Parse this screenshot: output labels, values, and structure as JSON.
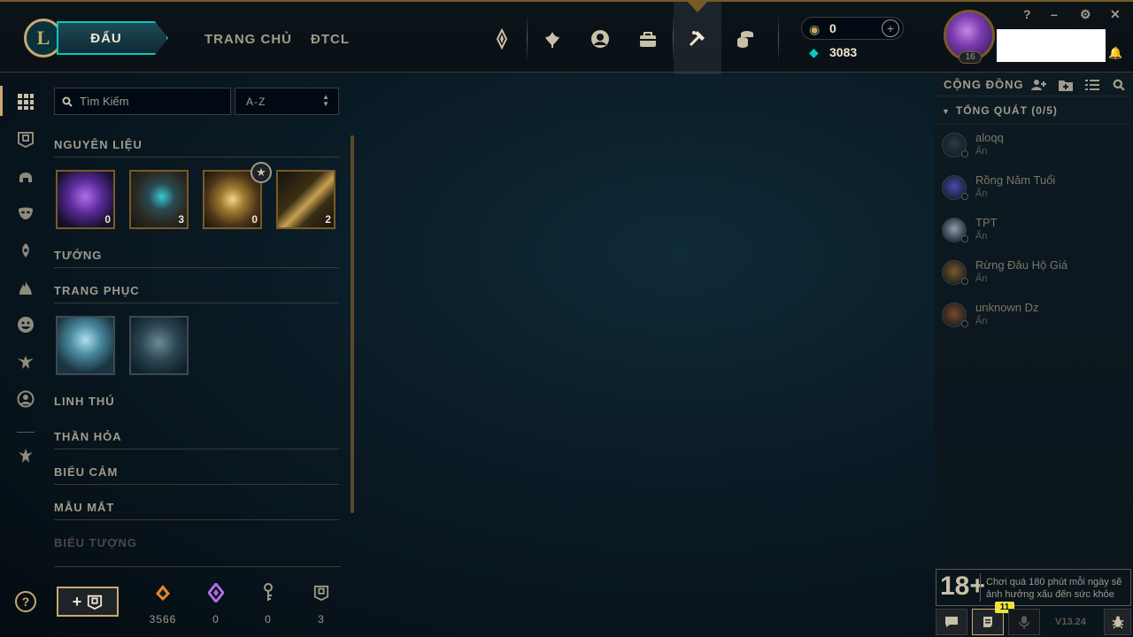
{
  "colors": {
    "gold": "#c8aa6e",
    "gold_dark": "#785a28",
    "teal": "#0ac8b9",
    "background": "#0a1a24",
    "text": "#a09b8c",
    "notification": "#f0e43c"
  },
  "header": {
    "logo_letter": "L",
    "play_button": "ĐẤU",
    "nav_links": [
      "TRANG CHỦ",
      "ĐTCL"
    ],
    "nav_icons": [
      "ranked-crest-icon",
      "challenges-icon",
      "profile-icon",
      "collection-icon",
      "loot-icon",
      "store-icon"
    ],
    "rp": "0",
    "blue_essence": "3083",
    "level": "16",
    "window_controls": [
      "?",
      "–",
      "⚙",
      "✕"
    ]
  },
  "rail": {
    "icons": [
      "grid-icon",
      "chest-icon",
      "champion-helmet-icon",
      "mask-icon",
      "ward-icon",
      "spell-icon",
      "emote-icon",
      "bird-icon",
      "profile-circle-icon",
      "trophy-icon"
    ]
  },
  "loot": {
    "search_placeholder": "Tìm Kiếm",
    "sort_value": "A-Z",
    "sections": {
      "materials": "NGUYÊN LIỆU",
      "champions": "TƯỚNG",
      "skins": "TRANG PHỤC",
      "pets": "LINH THÚ",
      "gems": "THẦN HỎA",
      "emotes": "BIỂU CẢM",
      "eye_colors": "MẪU MẮT",
      "icons": "BIỂU TƯỢNG"
    },
    "materials": [
      {
        "name": "gemstone",
        "count": "0"
      },
      {
        "name": "hextech-chest",
        "count": "3"
      },
      {
        "name": "masterwork-chest",
        "count": "0"
      },
      {
        "name": "hextech-key",
        "count": "2"
      }
    ],
    "skins": [
      "skin-1",
      "skin-2"
    ]
  },
  "bottom": {
    "help": "?",
    "craft_plus": "+",
    "currencies": [
      {
        "icon": "orange-essence-icon",
        "value": "3566",
        "color": "#e8862a"
      },
      {
        "icon": "mythic-essence-icon",
        "value": "0",
        "color": "#b06ee8"
      },
      {
        "icon": "key-fragment-icon",
        "value": "0",
        "color": "#a09b8c"
      },
      {
        "icon": "chest-icon",
        "value": "3",
        "color": "#a09b8c"
      }
    ]
  },
  "social": {
    "title": "CỘNG ĐỒNG",
    "group": "TỔNG QUÁT (0/5)",
    "friends": [
      {
        "name": "aloqq",
        "status": "Ẩn",
        "color": "#2a3a44"
      },
      {
        "name": "Rồng Năm Tuổi",
        "status": "Ẩn",
        "color": "#4a4ab0"
      },
      {
        "name": "TPT",
        "status": "Ẩn",
        "color": "#8fa0b0"
      },
      {
        "name": "Rừng Đâu Hộ Giá",
        "status": "Ẩn",
        "color": "#7a5a2a"
      },
      {
        "name": "unknown Dz",
        "status": "Ẩn",
        "color": "#7a4a2a"
      }
    ],
    "warning_age": "18+",
    "warning_text": "Chơi quá 180 phút mỗi ngày sẽ ảnh hưởng xấu đến sức khỏe",
    "notification_count": "11",
    "version": "V13.24"
  }
}
